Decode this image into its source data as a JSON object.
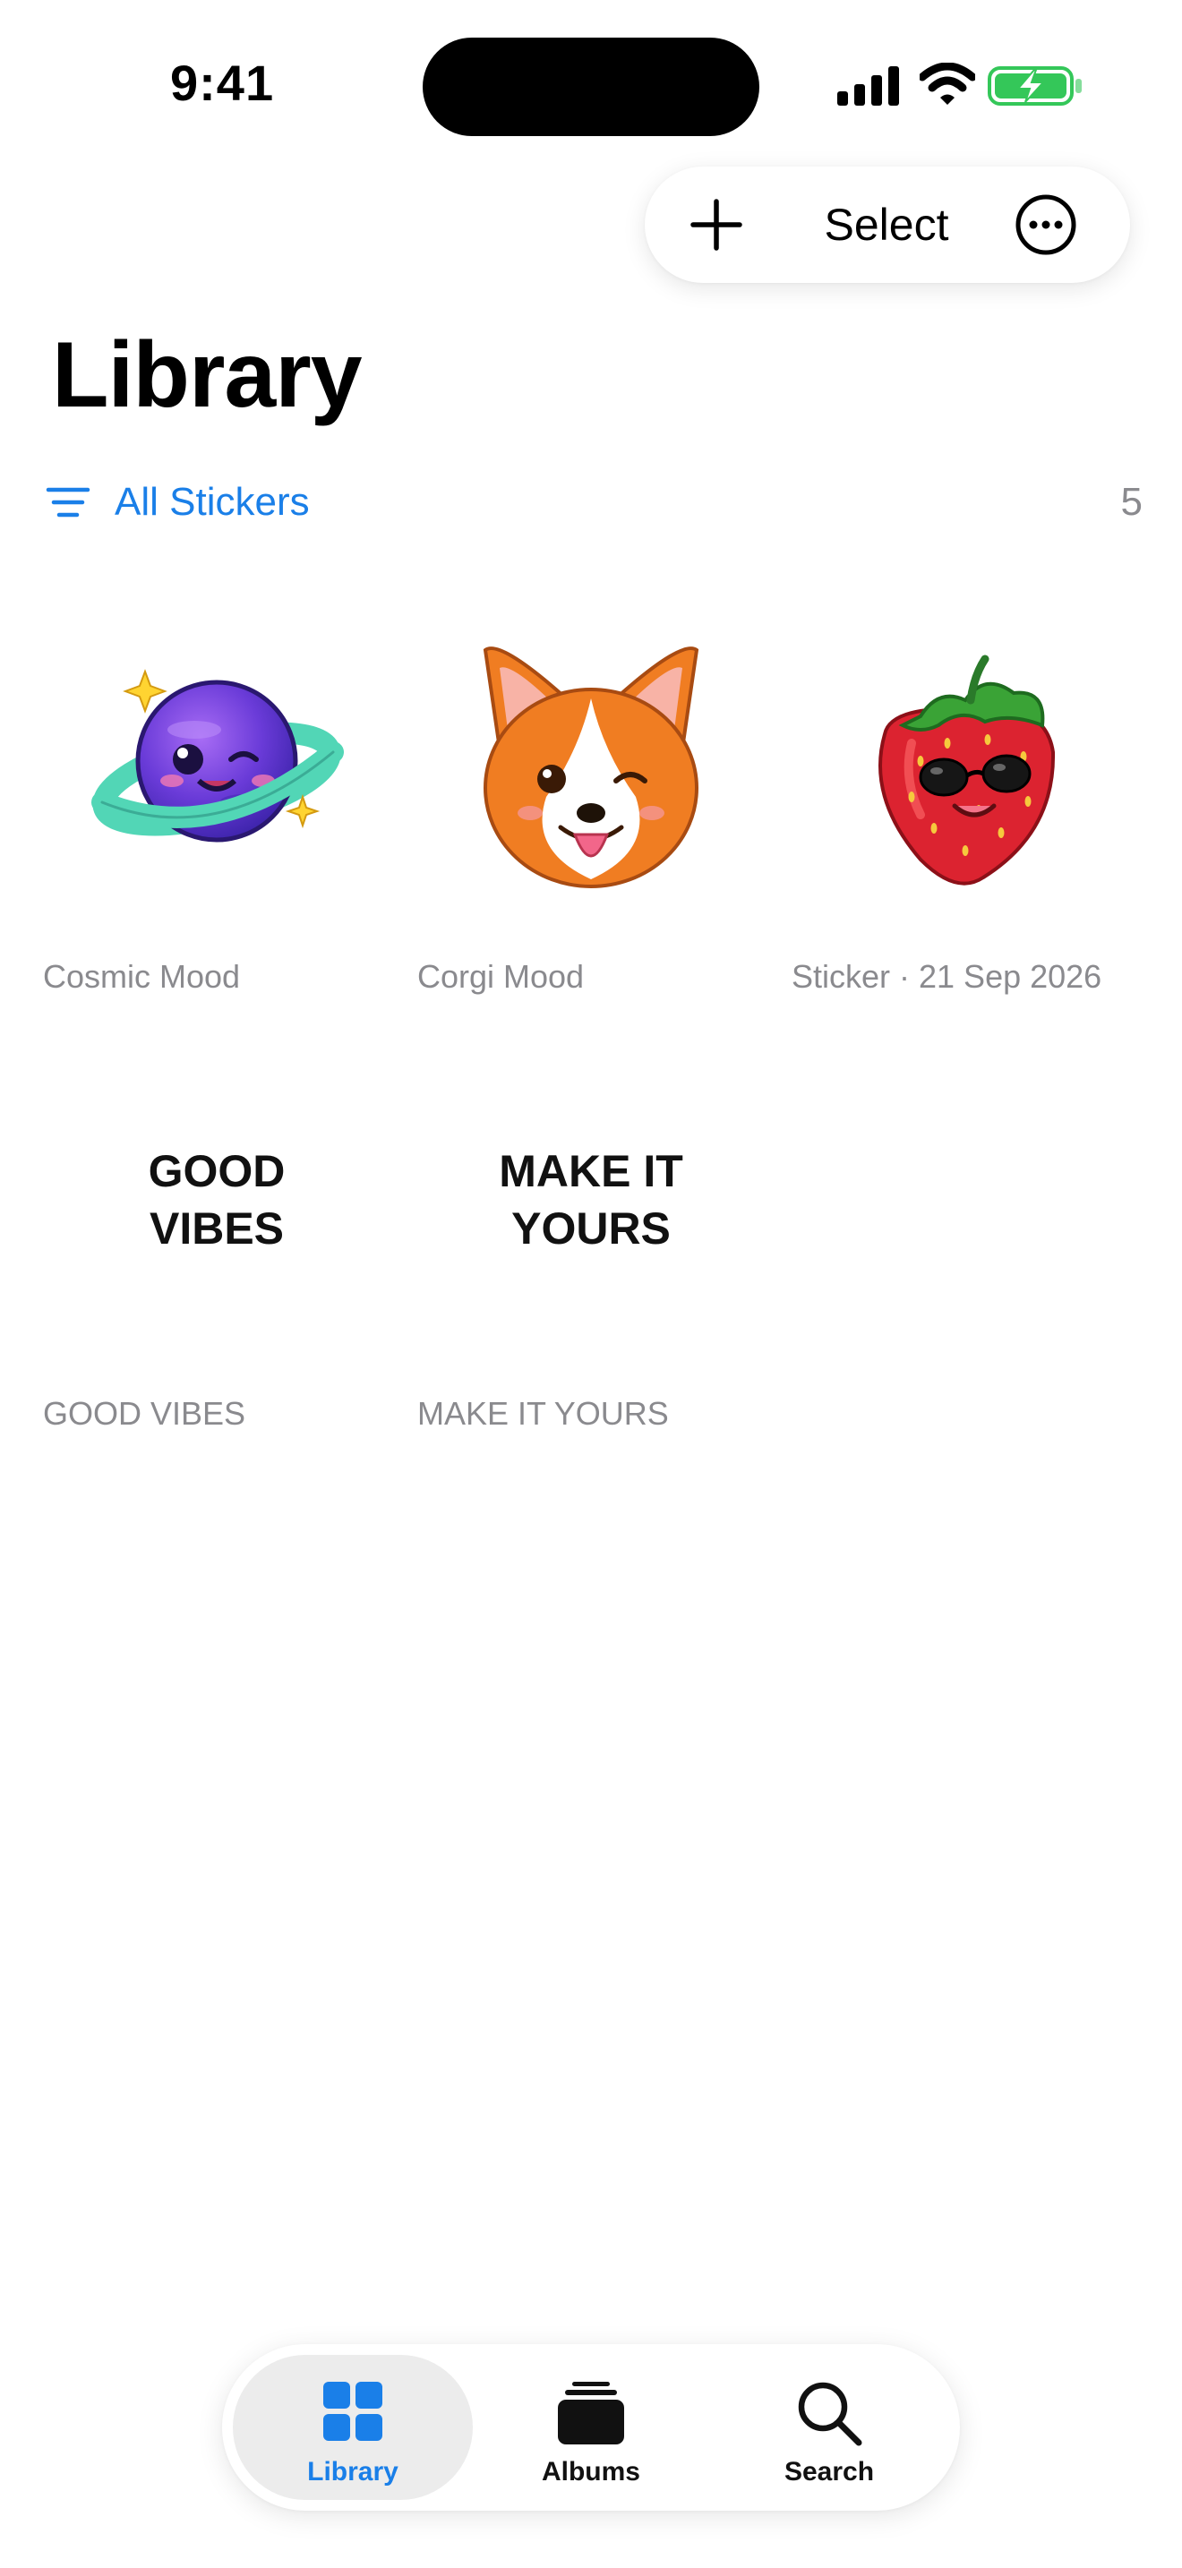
{
  "status_bar": {
    "time": "9:41"
  },
  "toolbar": {
    "add_icon": "plus-icon",
    "select_label": "Select",
    "more_icon": "ellipsis-circle-icon"
  },
  "page": {
    "title": "Library"
  },
  "filter": {
    "label": "All Stickers",
    "icon": "filter-lines-icon",
    "count": "5"
  },
  "stickers": [
    {
      "caption": "Cosmic Mood",
      "kind": "image",
      "image": "planet-sticker"
    },
    {
      "caption": "Corgi Mood",
      "kind": "image",
      "image": "corgi-sticker"
    },
    {
      "caption": "Sticker · 21 Sep 2026",
      "kind": "image",
      "image": "strawberry-sticker"
    },
    {
      "caption": "GOOD VIBES",
      "kind": "text",
      "text": "GOOD\nVIBES"
    },
    {
      "caption": "MAKE IT YOURS",
      "kind": "text",
      "text": "MAKE IT\nYOURS"
    }
  ],
  "tab_bar": {
    "tabs": [
      {
        "label": "Library",
        "icon": "grid-icon",
        "active": true
      },
      {
        "label": "Albums",
        "icon": "albums-stack-icon",
        "active": false
      },
      {
        "label": "Search",
        "icon": "magnifier-icon",
        "active": false
      }
    ]
  },
  "colors": {
    "accent": "#1a7fe8",
    "secondary_text": "#8a8a8e",
    "battery_green": "#34c759"
  }
}
